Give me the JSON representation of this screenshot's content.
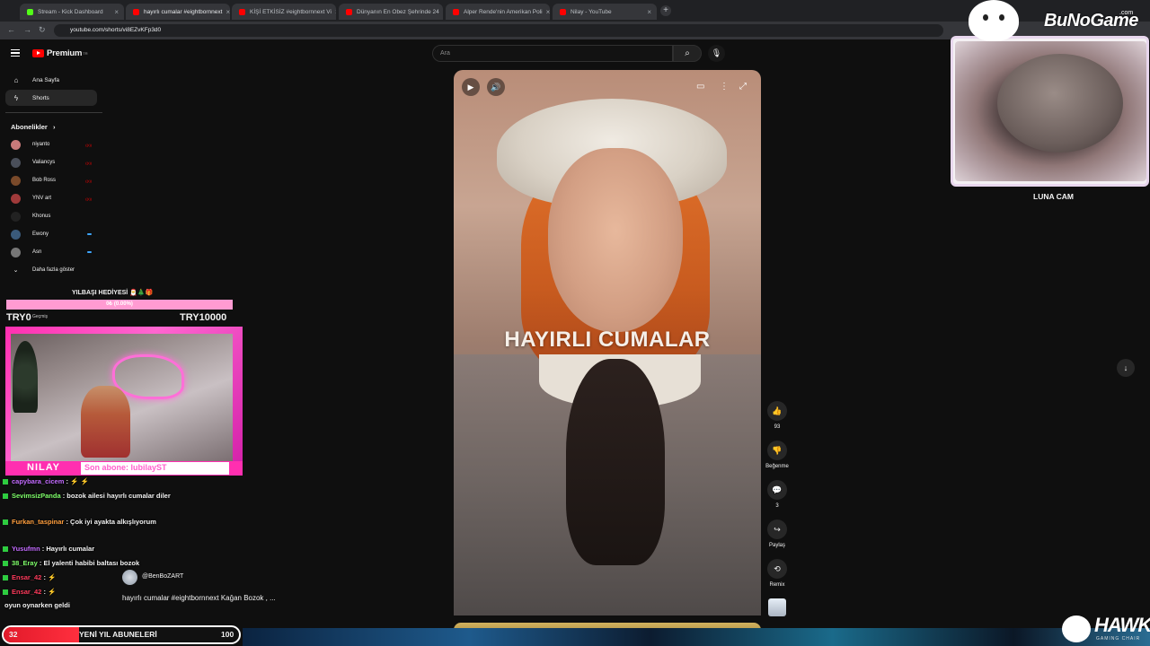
{
  "browser": {
    "tabs": [
      {
        "label": "Stream - Kick Dashboard",
        "color": "#53fc18"
      },
      {
        "label": "hayırlı cumalar #eightbornnext",
        "color": "#ff0000"
      },
      {
        "label": "KİŞİ ETKİSİZ #eightbornnext Vi",
        "color": "#ff0000"
      },
      {
        "label": "Dünyanın En Obez Şehrinde 24",
        "color": "#ff0000"
      },
      {
        "label": "Alper Rende'nin Amerikan Poli",
        "color": "#ff0000"
      },
      {
        "label": "Nilay - YouTube",
        "color": "#ff0000"
      }
    ],
    "url": "youtube.com/shorts/vi8EZvKFp3d0",
    "newtab": "+",
    "close": "×"
  },
  "youtube": {
    "logo_text": "Premium",
    "logo_region": "TR",
    "nav": [
      {
        "label": "Ana Sayfa",
        "icon": "home-icon",
        "glyph": "⌂"
      },
      {
        "label": "Shorts",
        "icon": "shorts-icon",
        "glyph": "ϟ"
      }
    ],
    "subs_title": "Abonelikler",
    "subs_chevron": "›",
    "subscriptions": [
      {
        "name": "niyanto",
        "avatar": "#c97a7a",
        "indicator": "live",
        "live": "((•))"
      },
      {
        "name": "Valiancys",
        "avatar": "#4a4f5a",
        "indicator": "live",
        "live": "((•))"
      },
      {
        "name": "Bob Ross",
        "avatar": "#7a4a2a",
        "indicator": "live",
        "live": "((•))"
      },
      {
        "name": "YNV art",
        "avatar": "#a03a3a",
        "indicator": "live",
        "live": "((•))"
      },
      {
        "name": "Khonus",
        "avatar": "#222",
        "indicator": "none"
      },
      {
        "name": "Ewony",
        "avatar": "#3a5a7a",
        "indicator": "dot"
      },
      {
        "name": "Asn",
        "avatar": "#777",
        "indicator": "dot"
      }
    ],
    "show_more": "Daha fazla göster",
    "search_placeholder": "Ara",
    "search_icon": "search-icon",
    "mic_icon": "mic-icon",
    "video_title_overlay": "HAYIRLI CUMALAR",
    "actions": {
      "like_count": "93",
      "dislike_label": "Beğenme",
      "comments_count": "3",
      "share_label": "Paylaş",
      "remix_label": "Remix"
    },
    "channel_name": "@BenBoZART",
    "description": "hayırlı cumalar #eightbornnext  Kağan Bozok , ..."
  },
  "stream_overlay": {
    "gift_title": "YILBAŞI HEDİYESİ 🎅🎄🎁",
    "gift_progress_text": "0₺ (0.00%)",
    "gift_progress": 0,
    "try_left": "TRY0",
    "try_right": "TRY10000",
    "history_label": "Geçmiş",
    "streamer_name": "NILAY",
    "last_sub": "Son abone: lubilayST",
    "cat_cam_label": "LUNA CAM",
    "bungame": "BuNoGame",
    "bungame_suffix": ".com",
    "hawk": "HAWK",
    "hawk_sub": "GAMING CHAIR"
  },
  "chat": [
    {
      "name": "capybara_cicem",
      "name_color": "#c36bff",
      "msg": " : ⚡ ⚡"
    },
    {
      "name": "SevimsizPanda",
      "name_color": "#7fff6a",
      "msg": " : bozok ailesi hayırlı cumalar diler"
    },
    {
      "name": "Furkan_taspinar",
      "name_color": "#ff9e3d",
      "msg": " : Çok iyi ayakta alkışlıyorum"
    },
    {
      "name": "Yusufmn",
      "name_color": "#c36bff",
      "msg": " : Hayırlı cumalar"
    },
    {
      "name": "38_Eray",
      "name_color": "#7fff6a",
      "msg": " : El yalenti habibi baltası bozok"
    },
    {
      "name": "Ensar_42",
      "name_color": "#ff3b5c",
      "msg": " : ⚡"
    },
    {
      "name": "Ensar_42",
      "name_color": "#ff3b5c",
      "msg": " : ⚡"
    },
    {
      "name": "",
      "name_color": "#fff",
      "msg": "oyun oynarken geldi"
    }
  ],
  "sub_goal": {
    "current": "32",
    "label": "YENİ YIL ABUNELERİ",
    "max": "100",
    "progress": 0.32
  }
}
